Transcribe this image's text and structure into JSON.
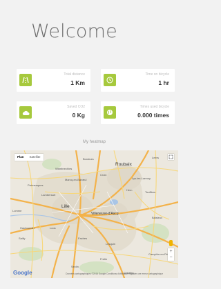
{
  "header": {
    "title": "Welcome"
  },
  "stats": [
    {
      "label": "Total distance",
      "value": "1 Km",
      "icon": "road-icon"
    },
    {
      "label": "Time on bicycle",
      "value": "1 hr",
      "icon": "clock-icon"
    },
    {
      "label": "Saved CO2",
      "value": "0 Kg",
      "icon": "cloud-icon"
    },
    {
      "label": "Times used bicycle",
      "value": "0.000 times",
      "icon": "globe-icon"
    }
  ],
  "heatmap": {
    "title": "My heatmap",
    "map_tab": "Plan",
    "satellite_tab": "Satellite",
    "google": "Google",
    "attribution": "Données cartographiques ©2016 Google   Conditions d'utilisation   Signaler une erreur cartographique",
    "zoom_in": "+",
    "zoom_out": "−",
    "towns": {
      "roubaix": "Roubaix",
      "lille": "Lille",
      "villeneuve": "Villeneuve-d'Ascq",
      "marcq": "Marcq-en-Barœul",
      "tourcoing": "Tourcoing",
      "lambersart": "Lambersart",
      "wambrechies": "Wambrechies",
      "lys": "Lys-lez-Lannoy",
      "seclin": "Seclin",
      "lesquin": "Lesquin",
      "croix": "Croix",
      "wattrelos": "Wattrelos",
      "haubourdin": "Haubourdin",
      "loos": "Loos",
      "faches": "Faches",
      "templemars": "Templemars",
      "cysoing": "Cysoing",
      "sainghin": "Sainghin",
      "toufflers": "Toufflers",
      "leers": "Leers",
      "hem": "Hem",
      "wasquehal": "Wasquehal",
      "baisieux": "Baisieux",
      "camphin": "Camphin-en-Pévèle",
      "fretin": "Fretin",
      "ronchin": "Ronchin",
      "lomme": "Lomme",
      "englos": "Englos",
      "prémesques": "Prémesques",
      "sailly": "Sailly",
      "capinghem": "Capinghem",
      "mouvaux": "Mouvaux",
      "bondues": "Bondues"
    }
  },
  "colors": {
    "accent": "#a6c93d",
    "background": "#f2f2f2",
    "card": "#ffffff"
  }
}
